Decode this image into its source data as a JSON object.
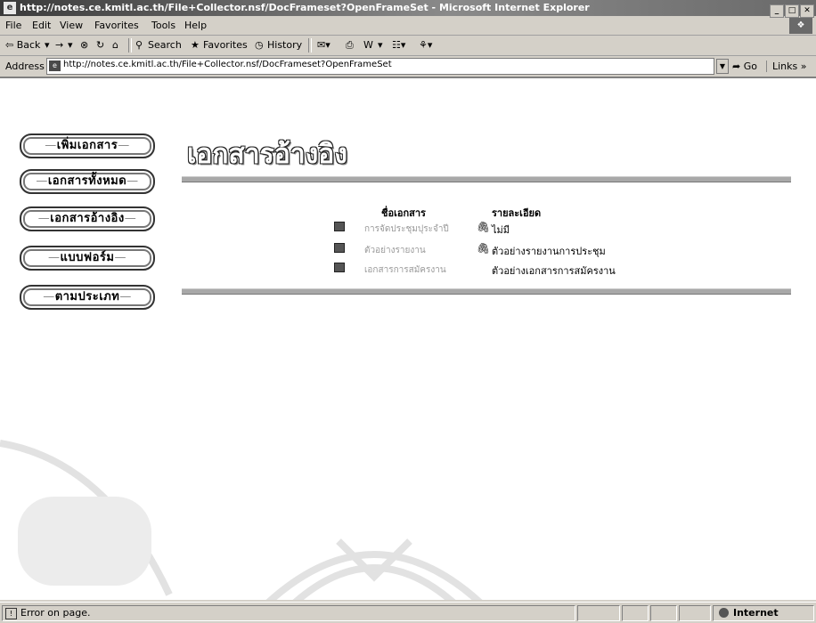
{
  "window": {
    "title": "http://notes.ce.kmitl.ac.th/File+Collector.nsf/DocFrameset?OpenFrameSet - Microsoft Internet Explorer",
    "controls": [
      "_",
      "̱",
      "x"
    ]
  },
  "menu": [
    "File",
    "Edit",
    "View",
    "Favorites",
    "Tools",
    "Help"
  ],
  "toolbar": {
    "back": "⇦ Back",
    "forward": "→",
    "search": "Search",
    "favorites": "Favorites",
    "history": "History"
  },
  "address": {
    "label": "Address",
    "url": "http://notes.ce.kmitl.ac.th/File+Collector.nsf/DocFrameset?OpenFrameSet",
    "go": "Go",
    "links": "Links"
  },
  "nav": [
    "เพิ่มเอกสาร",
    "เอกสารทั้งหมด",
    "เอกสารอ้างอิง",
    "แบบฟอร์ม",
    "ตามประเภท"
  ],
  "page": {
    "title": "เอกสารอ้างอิง",
    "col_name": "ชื่อเอกสาร",
    "col_detail": "รายละเอียด",
    "rows": [
      {
        "name": "การจัดประชุมปุระจำปี",
        "detail": "ไม่มี",
        "attached": true
      },
      {
        "name": "ตัวอย่างรายงาน",
        "detail": "ตัวอย่างรายงานการประชุม",
        "attached": true
      },
      {
        "name": "เอกสารการสมัครงาน",
        "detail": "ตัวอย่างเอกสารการสมัครงาน",
        "attached": false
      }
    ]
  },
  "status": {
    "message": "Error on page.",
    "zone": "Internet"
  }
}
